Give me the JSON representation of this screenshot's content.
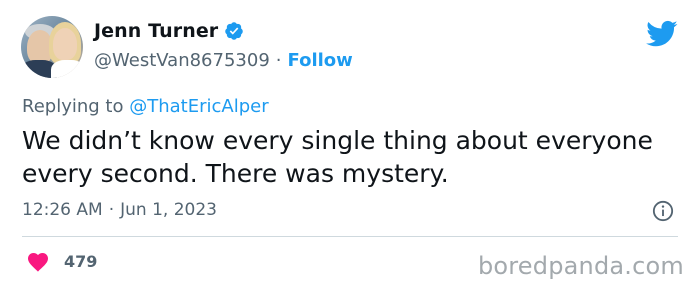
{
  "user": {
    "display_name": "Jenn Turner",
    "handle": "@WestVan8675309",
    "separator": "·",
    "follow_label": "Follow",
    "verified_icon": "verified-badge-icon",
    "avatar": "avatar"
  },
  "reply": {
    "prefix": "Replying to",
    "mention": "@ThatEricAlper"
  },
  "tweet": {
    "text": "We didn’t know every single thing about everyone every second. There was mystery.",
    "time": "12:26 AM",
    "separator": "·",
    "date": "Jun 1, 2023"
  },
  "stats": {
    "likes": "479"
  },
  "watermark": "boredpanda.com",
  "colors": {
    "accent": "#1d9bf0",
    "like": "#f91880",
    "muted": "#536471",
    "text": "#0f1419"
  }
}
